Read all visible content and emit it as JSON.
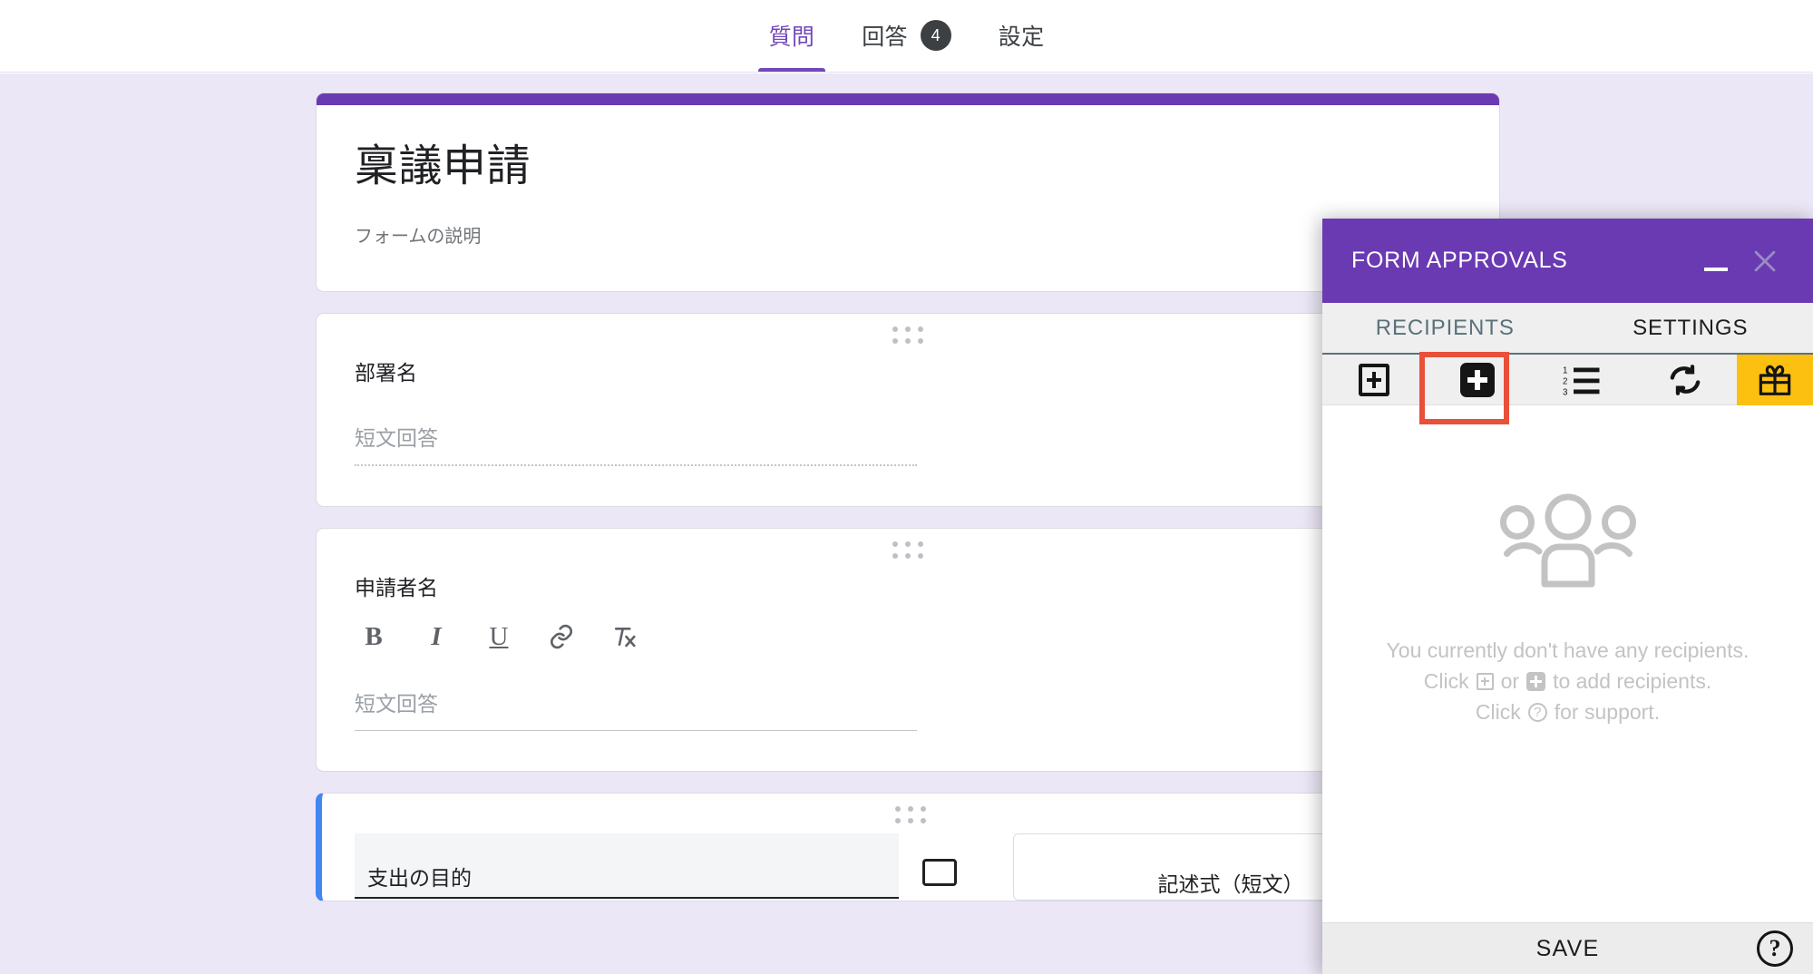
{
  "topbar": {
    "tabs": [
      {
        "label": "質問",
        "badge": null,
        "active": true
      },
      {
        "label": "回答",
        "badge": "4",
        "active": false
      },
      {
        "label": "設定",
        "badge": null,
        "active": false
      }
    ]
  },
  "form": {
    "title": "稟議申請",
    "description": "フォームの説明",
    "accent_color": "#6a3ab2",
    "background_color": "#ece7f6",
    "questions": [
      {
        "label": "部署名",
        "answer_placeholder": "短文回答",
        "has_format_toolbar": false,
        "selected": false
      },
      {
        "label": "申請者名",
        "answer_placeholder": "短文回答",
        "has_format_toolbar": true,
        "selected": false,
        "format_tools": [
          {
            "name": "bold-icon",
            "glyph": "B"
          },
          {
            "name": "italic-icon",
            "glyph": "I"
          },
          {
            "name": "underline-icon",
            "glyph": "U"
          },
          {
            "name": "link-icon",
            "glyph": "ὑ7"
          },
          {
            "name": "clear-formatting-icon",
            "glyph": "T"
          }
        ]
      },
      {
        "label": "支出の目的",
        "question_type": "記述式（短文）",
        "selected": true
      }
    ]
  },
  "panel": {
    "title": "FORM APPROVALS",
    "header_color": "#6a3ab2",
    "minimize_label": "minimize",
    "close_label": "close",
    "tabs": [
      {
        "label": "RECIPIENTS",
        "active": true
      },
      {
        "label": "SETTINGS",
        "active": false
      }
    ],
    "toolbar": [
      {
        "name": "add-recipient-outline-icon",
        "label": "Add recipient",
        "highlighted": false
      },
      {
        "name": "add-recipient-filled-icon",
        "label": "Add recipient (quick)",
        "highlighted": true
      },
      {
        "name": "order-list-icon",
        "label": "Set approval order"
      },
      {
        "name": "refresh-icon",
        "label": "Refresh"
      },
      {
        "name": "gift-icon",
        "label": "Offers",
        "background": "#fcc011"
      }
    ],
    "highlight_color": "#e8503a",
    "empty_state": {
      "icon": "group-of-people-icon",
      "line1": "You currently don't have any recipients.",
      "line2_pre": "Click",
      "line2_mid": "or",
      "line2_post": "to add recipients.",
      "line3_pre": "Click",
      "line3_post": "for support."
    },
    "footer": {
      "save_label": "SAVE",
      "help_label": "?"
    }
  }
}
